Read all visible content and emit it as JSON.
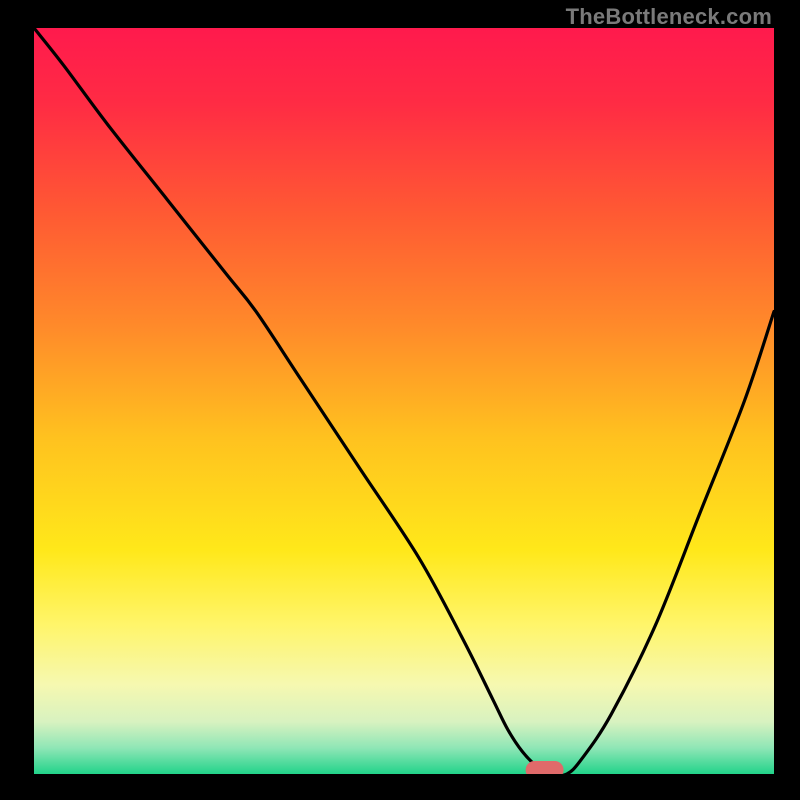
{
  "watermark": "TheBottleneck.com",
  "chart_data": {
    "type": "line",
    "title": "",
    "xlabel": "",
    "ylabel": "",
    "xlim": [
      0,
      100
    ],
    "ylim": [
      0,
      100
    ],
    "grid": false,
    "legend": false,
    "annotations": [
      {
        "type": "marker",
        "shape": "pill",
        "x": 69,
        "y": 0,
        "color": "#e06a6a"
      }
    ],
    "gradient_stops": [
      {
        "offset": 0.0,
        "color": "#ff1a4d"
      },
      {
        "offset": 0.1,
        "color": "#ff2b44"
      },
      {
        "offset": 0.25,
        "color": "#ff5a33"
      },
      {
        "offset": 0.4,
        "color": "#ff8a2a"
      },
      {
        "offset": 0.55,
        "color": "#ffc21f"
      },
      {
        "offset": 0.7,
        "color": "#ffe81a"
      },
      {
        "offset": 0.8,
        "color": "#fff56a"
      },
      {
        "offset": 0.88,
        "color": "#f6f8b0"
      },
      {
        "offset": 0.93,
        "color": "#d8f2c0"
      },
      {
        "offset": 0.965,
        "color": "#8fe6b6"
      },
      {
        "offset": 1.0,
        "color": "#22d38a"
      }
    ],
    "series": [
      {
        "name": "bottleneck-curve",
        "color": "#000000",
        "x": [
          0,
          4,
          10,
          18,
          26,
          30,
          36,
          44,
          52,
          58,
          62,
          64,
          66,
          68,
          70,
          72,
          74,
          78,
          84,
          90,
          96,
          100
        ],
        "y": [
          100,
          95,
          87,
          77,
          67,
          62,
          53,
          41,
          29,
          18,
          10,
          6,
          3,
          1,
          0,
          0,
          2,
          8,
          20,
          35,
          50,
          62
        ]
      }
    ]
  }
}
